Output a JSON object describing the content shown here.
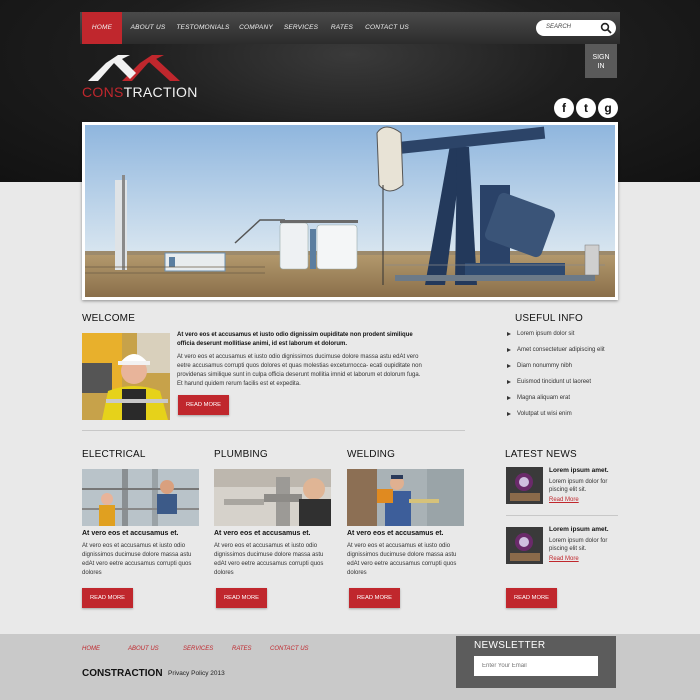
{
  "nav": {
    "items": [
      "HOME",
      "ABOUT US",
      "TESTOMONIALS",
      "COMPANY",
      "SERVICES",
      "RATES",
      "CONTACT US"
    ],
    "active_index": 0
  },
  "search": {
    "placeholder": "SEARCH"
  },
  "logo": {
    "part1": "CONS",
    "part2": "TRACTION"
  },
  "signin": {
    "line1": "SIGN",
    "line2": "IN"
  },
  "social": [
    {
      "name": "facebook-icon",
      "glyph": "f"
    },
    {
      "name": "twitter-icon",
      "glyph": "t"
    },
    {
      "name": "google-icon",
      "glyph": "g"
    }
  ],
  "welcome": {
    "title": "WELCOME",
    "bold_text": "At vero eos et accusamus et iusto odio dignissim oupiditate non prodent similique officia deserunt mollitiase animi, id est laborum et dolorum.",
    "text": "At vero eos et accusamus et iusto odio dignissimos ducimuse dolore massa astu edAt vero eetre accusamus corrupti quos dolores et quas molestias exceturnocca- ecati oupiditate non providenas similique sunt in culpa officia deserunt mollitia imnid et laborum et dolorum fuga. Et harund quidem rerum facilis est et expedita.",
    "button": "READ MORE"
  },
  "useful_info": {
    "title": "USEFUL INFO",
    "items": [
      "Lorem ipsum dolor sit",
      "Amet consectetuer adipiscing elit",
      "Diam nonummy nibh",
      "Euismod tincidunt ut laoreet",
      "Magna aliquam erat",
      "Volutpat ut wisi enim"
    ]
  },
  "services": [
    {
      "title": "ELECTRICAL",
      "head": "At vero eos et accusamus et.",
      "text": "At vero eos et accusamus et iusto odio dignissimos ducimuse dolore massa astu edAt vero eetre accusamus corrupti quos dolores",
      "button": "READ MORE"
    },
    {
      "title": "PLUMBING",
      "head": "At vero eos et accusamus et.",
      "text": "At vero eos et accusamus et iusto odio dignissimos ducimuse dolore massa astu edAt vero eetre accusamus corrupti quos dolores",
      "button": "READ MORE"
    },
    {
      "title": "WELDING",
      "head": "At vero eos et accusamus et.",
      "text": "At vero eos et accusamus et iusto odio dignissimos ducimuse dolore massa astu edAt vero eetre accusamus corrupti quos dolores",
      "button": "READ MORE"
    }
  ],
  "latest_news": {
    "title": "LATEST NEWS",
    "items": [
      {
        "head": "Lorem ipsum amet.",
        "text": "Lorem ipsum dolor for piscing elit sit.",
        "link": "Read More"
      },
      {
        "head": "Lorem ipsum amet.",
        "text": "Lorem ipsum dolor for piscing elit sit.",
        "link": "Read More"
      }
    ],
    "button": "READ MORE"
  },
  "footer": {
    "links": [
      "HOME",
      "ABOUT US",
      "SERVICES",
      "RATES",
      "CONTACT US"
    ],
    "brand": "CONSTRACTION",
    "copyright": "Privacy Policy 2013"
  },
  "newsletter": {
    "title": "NEWSLETTER",
    "placeholder": "Enter Your Email"
  },
  "colors": {
    "accent": "#c0272d",
    "dark": "#1e1e1e",
    "light_bg": "#e9e9e9"
  }
}
